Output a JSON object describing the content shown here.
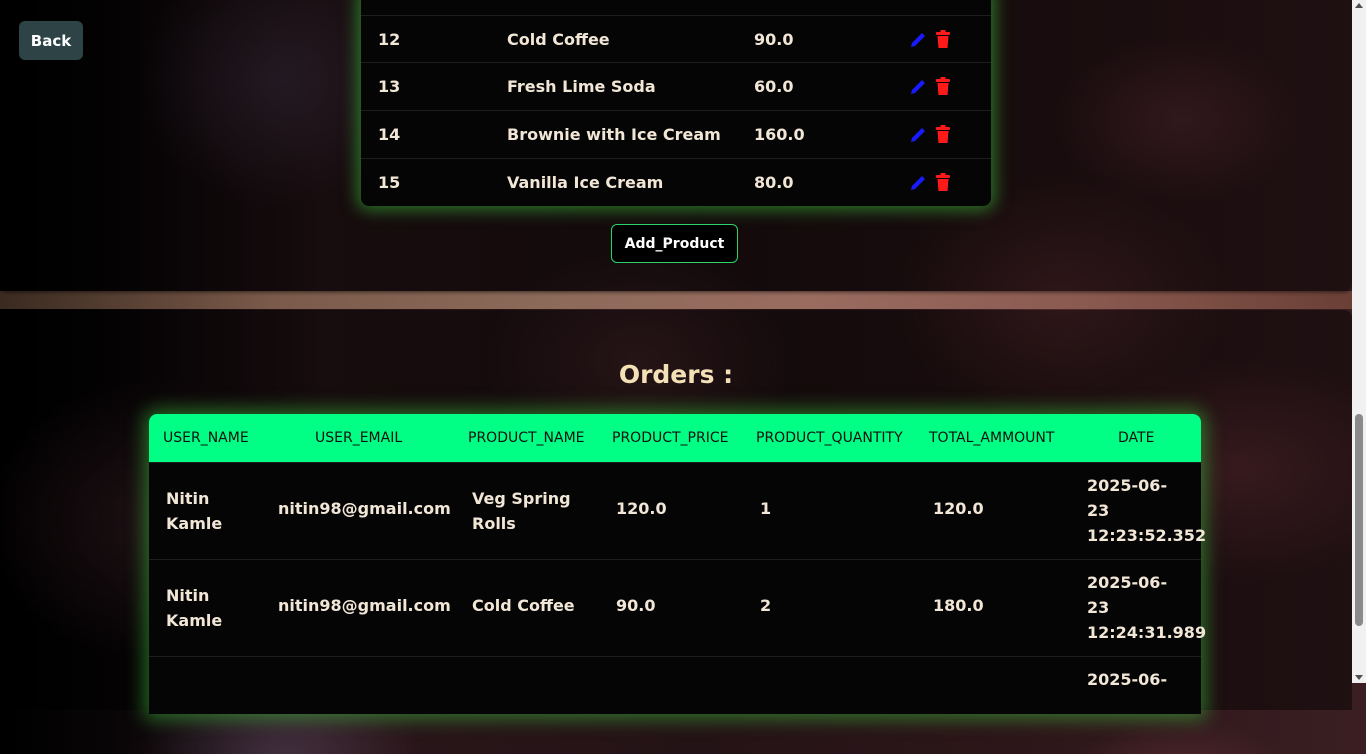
{
  "nav": {
    "back_label": "Back"
  },
  "products": {
    "rows": [
      {
        "id": "12",
        "name": "Cold Coffee",
        "price": "90.0"
      },
      {
        "id": "13",
        "name": "Fresh Lime Soda",
        "price": "60.0"
      },
      {
        "id": "14",
        "name": "Brownie with Ice Cream",
        "price": "160.0"
      },
      {
        "id": "15",
        "name": "Vanilla Ice Cream",
        "price": "80.0"
      }
    ],
    "add_label": "Add_Product",
    "icons": {
      "edit": "pencil-icon",
      "delete": "trash-icon"
    },
    "colors": {
      "edit": "#1a1aff",
      "delete": "#ff1a1a"
    }
  },
  "orders": {
    "title": "Orders :",
    "columns": [
      "USER_NAME",
      "USER_EMAIL",
      "PRODUCT_NAME",
      "PRODUCT_PRICE",
      "PRODUCT_QUANTITY",
      "TOTAL_AMMOUNT",
      "DATE"
    ],
    "rows": [
      {
        "user_name": [
          "Nitin",
          "Kamle"
        ],
        "email": "nitin98@gmail.com",
        "product": [
          "Veg Spring",
          "Rolls"
        ],
        "price": "120.0",
        "qty": "1",
        "total": "120.0",
        "date": [
          "2025-06-",
          "23",
          "12:23:52.352"
        ]
      },
      {
        "user_name": [
          "Nitin",
          "Kamle"
        ],
        "email": "nitin98@gmail.com",
        "product": [
          "Cold Coffee"
        ],
        "price": "90.0",
        "qty": "2",
        "total": "180.0",
        "date": [
          "2025-06-",
          "23",
          "12:24:31.989"
        ]
      },
      {
        "date": [
          "2025-06-"
        ]
      }
    ],
    "colors": {
      "header_bg": "#00ff84",
      "title": "#f3e0b6"
    }
  }
}
